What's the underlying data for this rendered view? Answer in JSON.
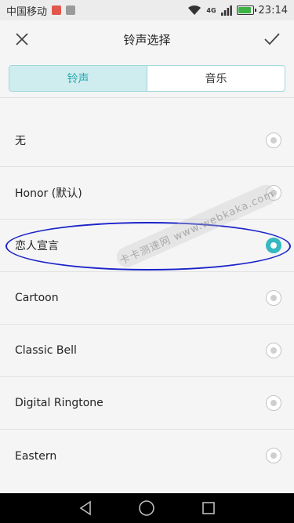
{
  "status_bar": {
    "carrier": "中国移动",
    "network": "4G",
    "time": "23:14",
    "battery_level": 0.9,
    "icons": [
      "app-notification-icon",
      "image-notification-icon",
      "wifi-icon",
      "signal-icon",
      "battery-icon"
    ]
  },
  "header": {
    "title": "铃声选择",
    "close_icon": "close-icon",
    "confirm_icon": "checkmark-icon"
  },
  "tabs": [
    {
      "label": "铃声",
      "active": true
    },
    {
      "label": "音乐",
      "active": false
    }
  ],
  "ringtones": [
    {
      "label": "无",
      "selected": false
    },
    {
      "label": "Honor (默认)",
      "selected": false
    },
    {
      "label": "恋人宣言",
      "selected": true
    },
    {
      "label": "Cartoon",
      "selected": false
    },
    {
      "label": "Classic Bell",
      "selected": false
    },
    {
      "label": "Digital Ringtone",
      "selected": false
    },
    {
      "label": "Eastern",
      "selected": false
    }
  ],
  "watermark": "卡卡测速网 www.webkaka.com",
  "nav_bar": {
    "icons": [
      "back-icon",
      "home-icon",
      "recents-icon"
    ]
  },
  "colors": {
    "accent": "#35b8c0",
    "annotation": "#1a23c9",
    "tab_active_bg": "#cfecee"
  }
}
